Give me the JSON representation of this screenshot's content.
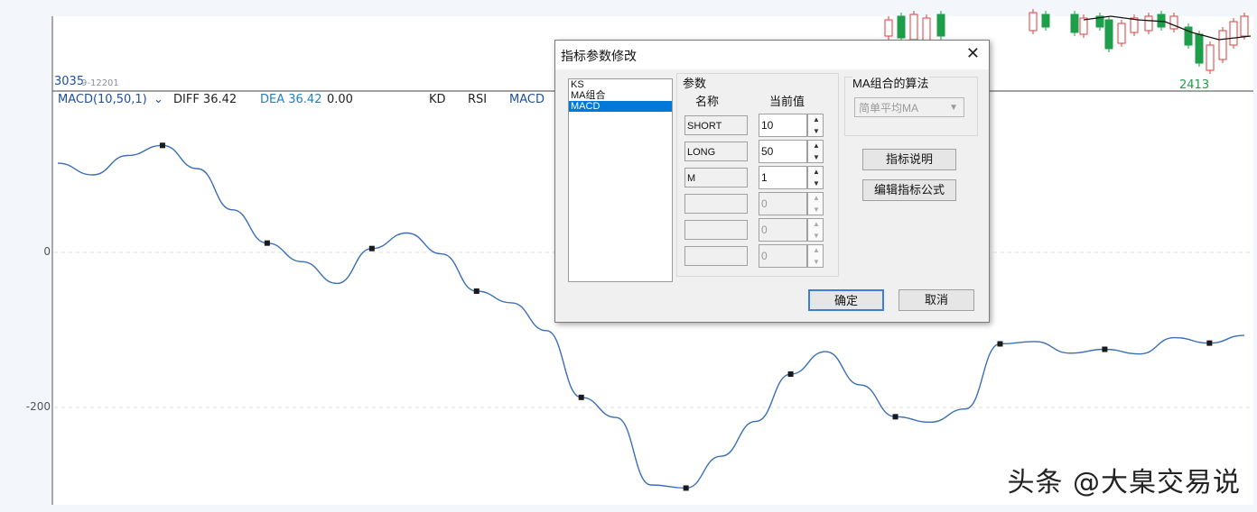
{
  "chart_header": {
    "stock_code_label": "3035",
    "stock_code_sub": "9-12201",
    "indicator_label": "MACD(10,50,1)",
    "diff_label": "DIFF 36.42",
    "dea_label": "DEA 36.42",
    "macd_value": "0.00",
    "tabs": [
      "KD",
      "RSI",
      "MACD"
    ]
  },
  "price_label": "2413",
  "chart_data": {
    "type": "line",
    "series": [
      {
        "values": [
          115,
          100,
          125,
          138,
          108,
          55,
          12,
          -12,
          -40,
          5,
          25,
          -2,
          -50,
          -65,
          -101,
          -187,
          -213,
          -300,
          -304,
          -263,
          -218,
          -157,
          -128,
          -171,
          -212,
          -219,
          -202,
          -118,
          -115,
          -130,
          -125,
          -131,
          -110,
          -117,
          -107
        ]
      }
    ],
    "y_ticks": [
      "0",
      "-200"
    ],
    "ylim": [
      -320,
      190
    ],
    "grid": true
  },
  "dialog": {
    "title": "指标参数修改",
    "close_glyph": "✕",
    "indicators": [
      "KS",
      "MA组合",
      "MACD"
    ],
    "selected_index": 2,
    "params_group_label": "参数",
    "col_name": "名称",
    "col_value": "当前值",
    "params": [
      {
        "name": "SHORT",
        "value": "10",
        "enabled": true
      },
      {
        "name": "LONG",
        "value": "50",
        "enabled": true
      },
      {
        "name": "M",
        "value": "1",
        "enabled": true
      },
      {
        "name": "",
        "value": "0",
        "enabled": false
      },
      {
        "name": "",
        "value": "0",
        "enabled": false
      },
      {
        "name": "",
        "value": "0",
        "enabled": false
      }
    ],
    "ma_group_label": "MA组合的算法",
    "ma_algorithm": "简单平均MA",
    "btn_description": "指标说明",
    "btn_edit_formula": "编辑指标公式",
    "btn_ok": "确定",
    "btn_cancel": "取消"
  },
  "watermark": "头条 @大臬交易说",
  "colors": {
    "line": "#3a6fb5",
    "up_candle": "#e23b3b",
    "down_candle": "#1e9e4a",
    "accent": "#0078d7"
  }
}
